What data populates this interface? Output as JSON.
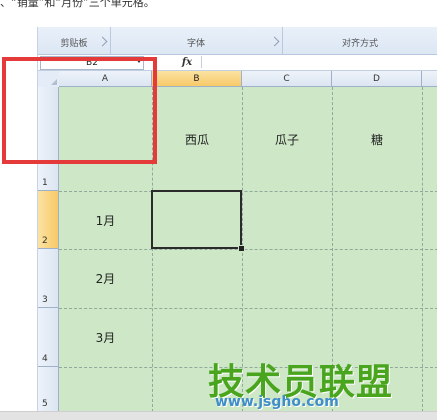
{
  "caption": "、“销量”和“月份”三个单元格。",
  "ribbon": {
    "groups": [
      {
        "label": "剪贴板"
      },
      {
        "label": "字体"
      },
      {
        "label": "对齐方式"
      }
    ]
  },
  "formula_bar": {
    "name_box": "B2",
    "fx_label": "fx",
    "content": ""
  },
  "columns": [
    "A",
    "B",
    "C",
    "D"
  ],
  "rows": [
    "1",
    "2",
    "3",
    "4",
    "5"
  ],
  "active_cell": "B2",
  "cells": {
    "b1": "西瓜",
    "c1": "瓜子",
    "d1": "糖",
    "a2": "1月",
    "a3": "2月",
    "a4": "3月"
  },
  "highlight_color": "#e53a3a",
  "watermark": {
    "title": "技术员联盟",
    "url": "www.jsgho.com"
  }
}
